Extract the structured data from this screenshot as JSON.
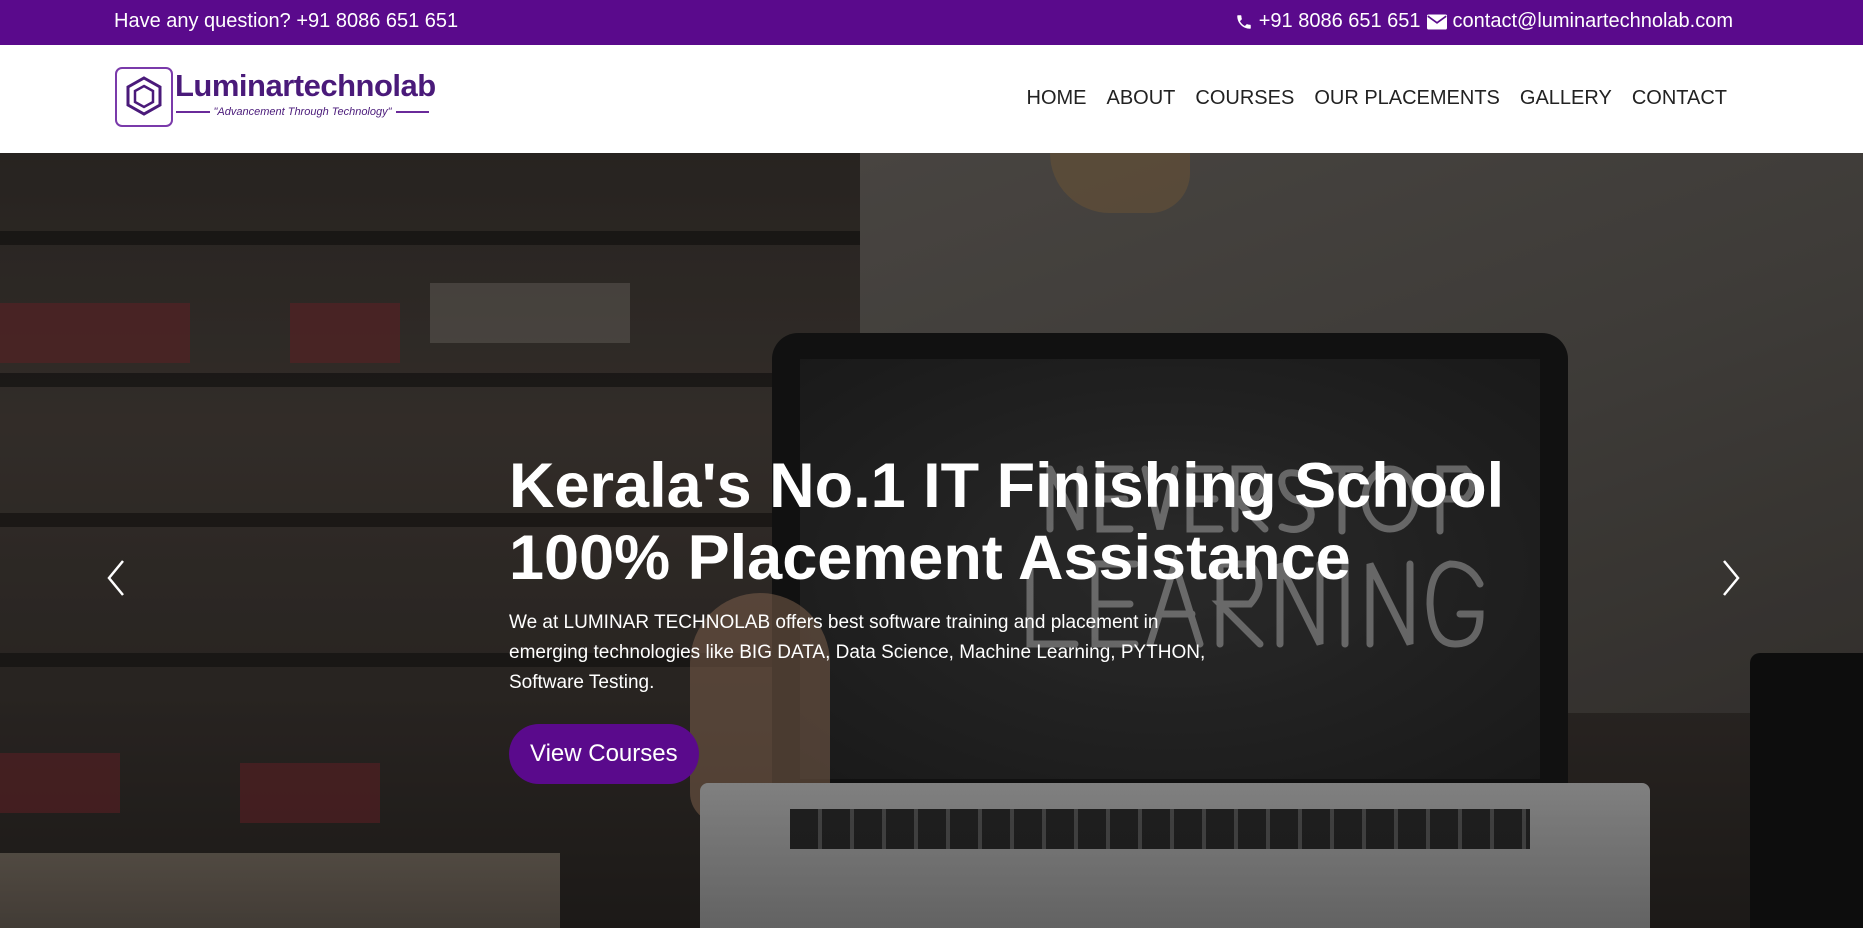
{
  "topbar": {
    "question": "Have any question? +91 8086 651 651",
    "phone": "+91 8086 651 651",
    "email": "contact@luminartechnolab.com",
    "phone_icon": "phone-icon",
    "mail_icon": "envelope-icon"
  },
  "logo": {
    "name": "Luminartechnolab",
    "tagline": "\"Advancement Through Technology\""
  },
  "nav": {
    "items": [
      "HOME",
      "ABOUT",
      "COURSES",
      "OUR PLACEMENTS",
      "GALLERY",
      "CONTACT"
    ]
  },
  "hero": {
    "title_line1": "Kerala's No.1 IT Finishing School",
    "title_line2": "100% Placement Assistance",
    "description": "We at LUMINAR TECHNOLAB offers best software training and placement in emerging technologies like BIG DATA, Data Science, Machine Learning, PYTHON, Software Testing.",
    "button": "View Courses",
    "prev_icon": "chevron-left-icon",
    "next_icon": "chevron-right-icon"
  },
  "colors": {
    "brand": "#5a0a8c",
    "logo_text": "#4a1a7a"
  }
}
